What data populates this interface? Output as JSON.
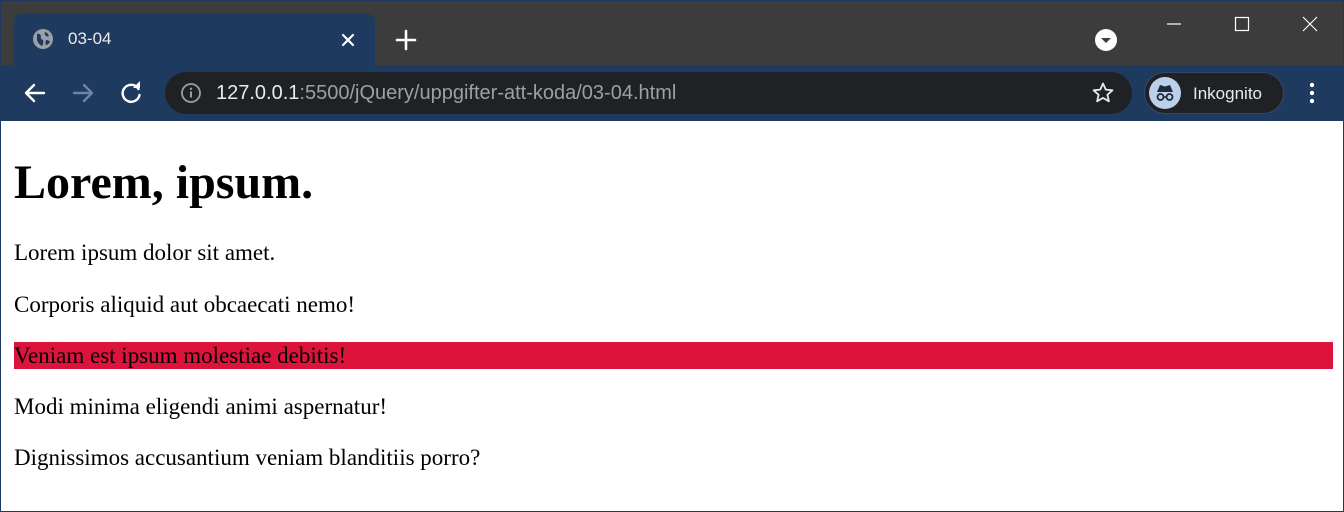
{
  "browser": {
    "tab": {
      "title": "03-04"
    },
    "address_bar": {
      "host": "127.0.0.1",
      "path": ":5500/jQuery/uppgifter-att-koda/03-04.html"
    },
    "profile": {
      "label": "Inkognito"
    },
    "colors": {
      "frame": "#1f3a5f",
      "tabstrip": "#3c3c3c",
      "omnibox": "#202124"
    },
    "icons": [
      "globe-icon",
      "close-icon",
      "plus-icon",
      "tab-search-icon",
      "minimize-icon",
      "maximize-icon",
      "window-close-icon",
      "back-arrow-icon",
      "forward-arrow-icon",
      "reload-icon",
      "info-icon",
      "star-icon",
      "incognito-icon",
      "kebab-menu-icon"
    ]
  },
  "page": {
    "heading": "Lorem, ipsum.",
    "paragraphs": [
      {
        "text": "Lorem ipsum dolor sit amet.",
        "highlighted": false
      },
      {
        "text": "Corporis aliquid aut obcaecati nemo!",
        "highlighted": false
      },
      {
        "text": "Veniam est ipsum molestiae debitis!",
        "highlighted": true
      },
      {
        "text": "Modi minima eligendi animi aspernatur!",
        "highlighted": false
      },
      {
        "text": "Dignissimos accusantium veniam blanditiis porro?",
        "highlighted": false
      }
    ],
    "highlight_color": "#dc143c"
  }
}
